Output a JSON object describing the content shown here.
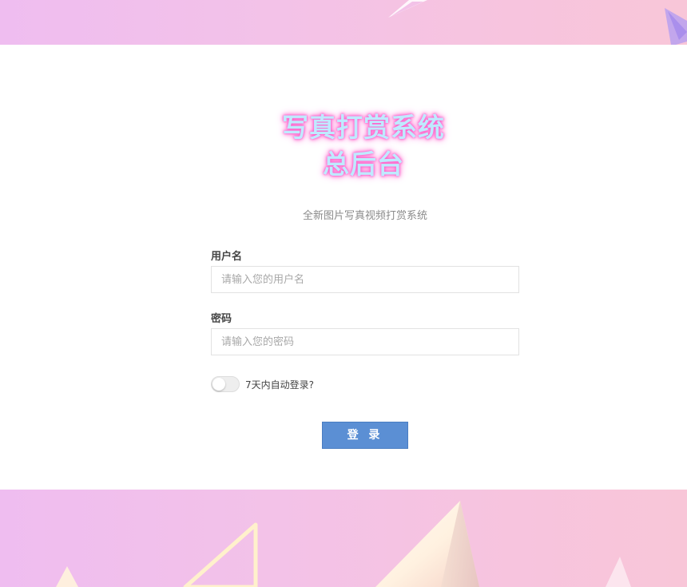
{
  "header": {
    "title_line1": "写真打赏系统",
    "title_line2": "总后台",
    "subtitle": "全新图片写真视频打赏系统"
  },
  "form": {
    "username_label": "用户名",
    "username_placeholder": "请输入您的用户名",
    "password_label": "密码",
    "password_placeholder": "请输入您的密码",
    "remember_label": "7天内自动登录?",
    "remember_checked": false,
    "submit_label": "登 录"
  },
  "colors": {
    "background_pink": "#f3c2e8",
    "button_blue": "#5b8fd4",
    "title_fill": "#bfeaff",
    "title_glow": "#ff5cc8"
  }
}
